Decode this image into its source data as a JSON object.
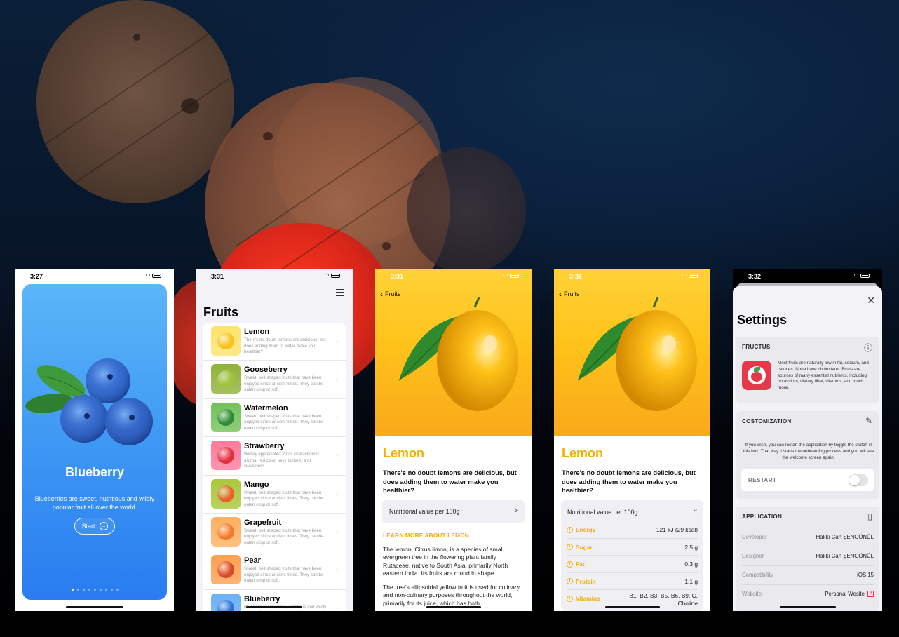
{
  "onboarding": {
    "time": "3:27",
    "title": "Blueberry",
    "description": "Blueberries are sweet, nutritious and wildly popular fruit all over the world.",
    "start_label": "Start",
    "start_icon": "arrow-right-circle-icon",
    "page_count": 9,
    "active_page": 0,
    "card_color": "#3b95f3"
  },
  "fruit_list": {
    "time": "3:31",
    "title": "Fruits",
    "items": [
      {
        "name": "Lemon",
        "description": "There's no doubt lemons are delicious, but does adding them to water make you healthier?",
        "color": "#f6c21d",
        "bg": "#fde36a"
      },
      {
        "name": "Gooseberry",
        "description": "Sweet, bell-shaped fruits that have been enjoyed since ancient times. They can be eaten crisp or soft.",
        "color": "#9fc33d",
        "bg": "#8fb13a"
      },
      {
        "name": "Watermelon",
        "description": "Sweet, bell-shaped fruits that have been enjoyed since ancient times. They can be eaten crisp or soft.",
        "color": "#2f8a3a",
        "bg": "#73c25a"
      },
      {
        "name": "Strawberry",
        "description": "Widely appreciated for its characteristic aroma, red color, juicy texture, and sweetness.",
        "color": "#e0303e",
        "bg": "#ff7a9a"
      },
      {
        "name": "Mango",
        "description": "Sweet, bell-shaped fruits that have been enjoyed since ancient times. They can be eaten crisp or soft.",
        "color": "#e8622a",
        "bg": "#a8c83a"
      },
      {
        "name": "Grapefruit",
        "description": "Sweet, bell-shaped fruits that have been enjoyed since ancient times. They can be eaten crisp or soft.",
        "color": "#f07a2a",
        "bg": "#ffb060"
      },
      {
        "name": "Pear",
        "description": "Sweet, bell-shaped fruits that have been enjoyed since ancient times. They can be eaten crisp or soft.",
        "color": "#d64a2a",
        "bg": "#ffa050"
      },
      {
        "name": "Blueberry",
        "description": "Blueberries are sweet, nutritious and wildly popular fruit all over the world.",
        "color": "#2f6fd8",
        "bg": "#6ab0f5"
      }
    ]
  },
  "detail_collapsed": {
    "time": "3:31",
    "back_label": "Fruits",
    "title": "Lemon",
    "headline": "There's no doubt lemons are delicious, but does adding them to water make you healthier?",
    "nutrition_label": "Nutritional value per 100g",
    "learn_more": "LEARN MORE ABOUT LEMON",
    "paragraphs": [
      "The lemon, Citrus limon, is a species of small evergreen tree in the flowering plant family Rutaceae, native to South Asia, primarily North eastern India. Its fruits are round in shape.",
      "The tree's ellipsoidal yellow fruit is used for culinary and non-culinary purposes throughout the world, primarily for its juice, which has both"
    ]
  },
  "detail_expanded": {
    "time": "3:32",
    "back_label": "Fruits",
    "title": "Lemon",
    "headline": "There's no doubt lemons are delicious, but does adding them to water make you healthier?",
    "nutrition_label": "Nutritional value per 100g",
    "nutrients": [
      {
        "name": "Energy",
        "value": "121 kJ (29 kcal)"
      },
      {
        "name": "Sugar",
        "value": "2.5 g"
      },
      {
        "name": "Fat",
        "value": "0.3 g"
      },
      {
        "name": "Protein",
        "value": "1.1 g"
      },
      {
        "name": "Vitamins",
        "value": "B1, B2, B3, B5, B6, B9, C, Choline"
      }
    ]
  },
  "settings": {
    "time": "3:32",
    "title": "Settings",
    "close_icon": "close-icon",
    "fructus": {
      "header": "FRUCTUS",
      "text": "Most fruits are naturally low in fat, sodium, and calories. None have cholesterol. Fruits are sources of many essential nutrients, including potassium, dietary fiber, vitamins, and much more."
    },
    "customization": {
      "header": "COSTOMIZATION",
      "text": "If you wish, you can restart the application by toggle the switch in this box. That way it starts the onboarding process and you will see the welcome screen again.",
      "restart_label": "RESTART",
      "restart_on": false
    },
    "application": {
      "header": "APPLICATION",
      "rows": [
        {
          "key": "Developer",
          "value": "Hakkı Can ŞENGÖNÜL"
        },
        {
          "key": "Designer",
          "value": "Hakkı Can ŞENGÖNÜL"
        },
        {
          "key": "Compatibility",
          "value": "iOS 15"
        },
        {
          "key": "Website",
          "value": "Personal Wesite"
        }
      ]
    },
    "accent_color": "#e6384b"
  },
  "colors": {
    "lemon_yellow": "#f4b000",
    "hero_yellow": "#ffc21a"
  }
}
